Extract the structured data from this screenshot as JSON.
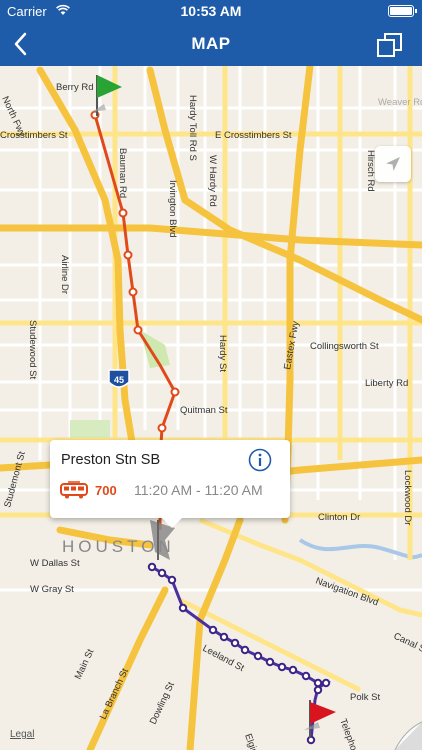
{
  "status_bar": {
    "carrier": "Carrier",
    "time": "10:53 AM"
  },
  "nav": {
    "title": "MAP",
    "back_icon": "chevron-left-icon",
    "copy_icon": "copy-icon"
  },
  "map": {
    "streets": [
      "North Fwy",
      "Berry Rd",
      "Bauman Rd",
      "E Crosstimbers St",
      "Crosstimbers St",
      "Hardy Toll Rd S",
      "W Hardy Rd",
      "Weaver Rd",
      "Irvington Blvd",
      "Hirsch Rd",
      "Airline Dr",
      "Studewood St",
      "Collingsworth St",
      "Liberty Rd",
      "Hardy St",
      "Eastex Fwy",
      "Quitman St",
      "Studemont St",
      "Clinton Dr",
      "Lockwood Dr",
      "W Dallas St",
      "W Gray St",
      "Navigation Blvd",
      "Canal St",
      "Main St",
      "La Branch St",
      "Leeland St",
      "Dowling St",
      "Elgin St",
      "Polk St",
      "Telephone Rd"
    ],
    "city_label": "HOUSTON",
    "highway_shield": "45",
    "legal": "Legal",
    "colors": {
      "orange_line": "#e04a1b",
      "purple_line": "#4a2fa0",
      "highway": "#f6c33e",
      "road_major": "#ffe58a",
      "start_flag": "#2aa335",
      "end_flag": "#d8141f"
    }
  },
  "callout": {
    "stop_name": "Preston Stn SB",
    "route": "700",
    "times": "11:20 AM - 11:20 AM",
    "info_icon": "info-icon",
    "bus_icon": "bus-icon"
  }
}
